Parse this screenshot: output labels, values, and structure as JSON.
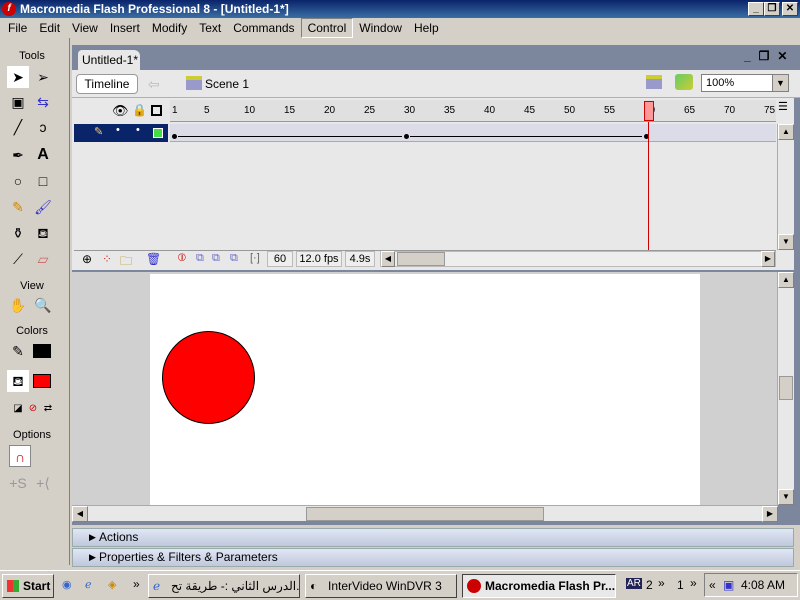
{
  "window": {
    "title": "Macromedia Flash Professional 8 - [Untitled-1*]",
    "minimize": "_",
    "restore": "❐",
    "close": "✕"
  },
  "menu": [
    "File",
    "Edit",
    "View",
    "Insert",
    "Modify",
    "Text",
    "Commands",
    "Control",
    "Window",
    "Help"
  ],
  "menu_active": "Control",
  "tools": {
    "title": "Tools",
    "view": "View",
    "colors": "Colors",
    "options": "Options",
    "stroke_color": "#000000",
    "fill_color": "#ff0000"
  },
  "document": {
    "tab": "Untitled-1*",
    "timeline_button": "Timeline",
    "scene": "Scene 1",
    "zoom": "100%"
  },
  "timeline": {
    "ruler": [
      "1",
      "5",
      "10",
      "15",
      "20",
      "25",
      "30",
      "35",
      "40",
      "45",
      "50",
      "55",
      "60",
      "65",
      "70",
      "75"
    ],
    "current_frame": "60",
    "fps": "12.0 fps",
    "elapsed": "4.9s",
    "keyframes": [
      1,
      30,
      60
    ]
  },
  "stage": {
    "circle_color": "#ff0000"
  },
  "panels": {
    "actions": "Actions",
    "properties": "Properties & Filters & Parameters"
  },
  "taskbar": {
    "start": "Start",
    "tasks": [
      "الدرس الثاني :- طريقة تح...",
      "InterVideo WinDVR 3",
      "Macromedia Flash Pr..."
    ],
    "lang": "AR",
    "count1": "2",
    "count2": "1",
    "clock": "4:08 AM"
  }
}
